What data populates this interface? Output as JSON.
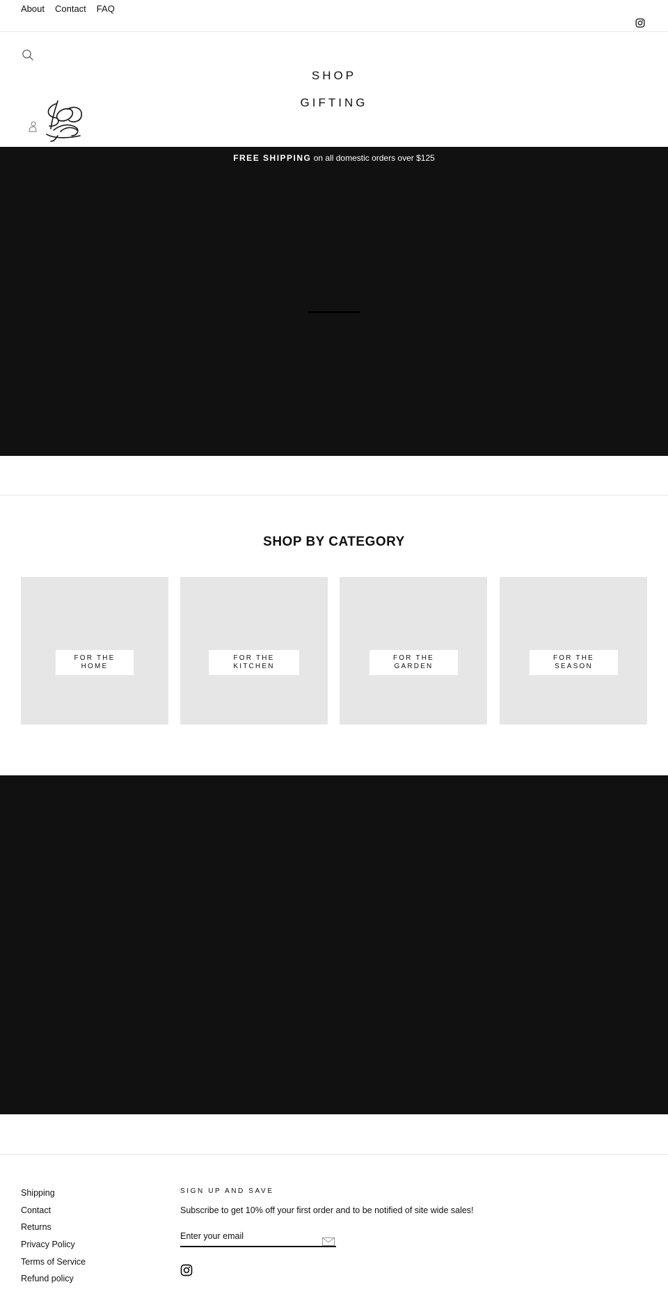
{
  "top_nav": {
    "links": [
      "About",
      "Contact",
      "FAQ"
    ],
    "social_icon": "instagram-icon"
  },
  "header": {
    "search_icon": "search-icon",
    "nav_items": [
      "SHOP",
      "GIFTING"
    ],
    "logo_alt": "logo",
    "user_icon": "user-icon"
  },
  "announcement": {
    "bold": "FREE SHIPPING",
    "rest": " on all domestic orders over $125"
  },
  "categories": {
    "title": "SHOP BY CATEGORY",
    "items": [
      {
        "line1": "FOR THE",
        "line2": "HOME"
      },
      {
        "line1": "FOR THE",
        "line2": "KITCHEN"
      },
      {
        "line1": "FOR THE",
        "line2": "GARDEN"
      },
      {
        "line1": "FOR THE",
        "line2": "SEASON"
      }
    ]
  },
  "footer": {
    "links": [
      "Shipping",
      "Contact",
      "Returns",
      "Privacy Policy",
      "Terms of Service",
      "Refund policy"
    ],
    "signup": {
      "heading": "SIGN UP AND SAVE",
      "body": "Subscribe to get 10% off your first order and to be notified of site wide sales!",
      "placeholder": "Enter your email",
      "submit_icon": "mail-icon"
    },
    "social_icon": "instagram-icon"
  },
  "colors": {
    "dark_band": "#111111",
    "tile_gray": "#e6e6e6",
    "text": "#111111"
  }
}
